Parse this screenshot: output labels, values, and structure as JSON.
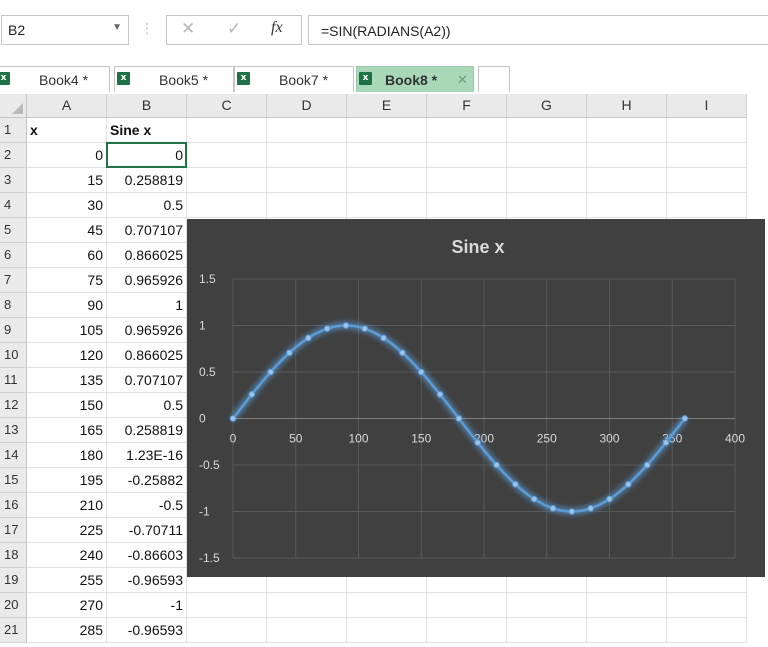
{
  "formula_bar": {
    "name_box": "B2",
    "cancel_icon": "✕",
    "enter_icon": "✓",
    "fx_label": "fx",
    "formula": "=SIN(RADIANS(A2))"
  },
  "tabs": [
    {
      "label": "Book4 *",
      "active": false
    },
    {
      "label": "Book5 *",
      "active": false
    },
    {
      "label": "Book7 *",
      "active": false
    },
    {
      "label": "Book8 *",
      "active": true,
      "close_icon": "✕"
    }
  ],
  "grid": {
    "columns": [
      "A",
      "B",
      "C",
      "D",
      "E",
      "F",
      "G",
      "H",
      "I"
    ],
    "rows": [
      {
        "num": "1",
        "a": "x",
        "b": "Sine x"
      },
      {
        "num": "2",
        "a": "0",
        "b": "0"
      },
      {
        "num": "3",
        "a": "15",
        "b": "0.258819"
      },
      {
        "num": "4",
        "a": "30",
        "b": "0.5"
      },
      {
        "num": "5",
        "a": "45",
        "b": "0.707107"
      },
      {
        "num": "6",
        "a": "60",
        "b": "0.866025"
      },
      {
        "num": "7",
        "a": "75",
        "b": "0.965926"
      },
      {
        "num": "8",
        "a": "90",
        "b": "1"
      },
      {
        "num": "9",
        "a": "105",
        "b": "0.965926"
      },
      {
        "num": "10",
        "a": "120",
        "b": "0.866025"
      },
      {
        "num": "11",
        "a": "135",
        "b": "0.707107"
      },
      {
        "num": "12",
        "a": "150",
        "b": "0.5"
      },
      {
        "num": "13",
        "a": "165",
        "b": "0.258819"
      },
      {
        "num": "14",
        "a": "180",
        "b": "1.23E-16"
      },
      {
        "num": "15",
        "a": "195",
        "b": "-0.25882"
      },
      {
        "num": "16",
        "a": "210",
        "b": "-0.5"
      },
      {
        "num": "17",
        "a": "225",
        "b": "-0.70711"
      },
      {
        "num": "18",
        "a": "240",
        "b": "-0.86603"
      },
      {
        "num": "19",
        "a": "255",
        "b": "-0.96593"
      },
      {
        "num": "20",
        "a": "270",
        "b": "-1"
      },
      {
        "num": "21",
        "a": "285",
        "b": "-0.96593"
      }
    ],
    "selected_cell": "B2"
  },
  "colors": {
    "chart_bg": "#404040",
    "series_line": "#5b9bd5",
    "axis_text": "#d9d9d9",
    "gridline": "#595959",
    "active_tab": "#a9d8b8",
    "selection": "#217346"
  },
  "chart_data": {
    "type": "scatter",
    "title": "Sine x",
    "xlabel": "",
    "ylabel": "",
    "xlim": [
      0,
      400
    ],
    "ylim": [
      -1.5,
      1.5
    ],
    "x_ticks": [
      "0",
      "50",
      "100",
      "150",
      "200",
      "250",
      "300",
      "350",
      "400"
    ],
    "y_ticks": [
      "1.5",
      "1",
      "0.5",
      "0",
      "-0.5",
      "-1",
      "-1.5"
    ],
    "grid": true,
    "smooth": true,
    "series": [
      {
        "x": [
          0,
          15,
          30,
          45,
          60,
          75,
          90,
          105,
          120,
          135,
          150,
          165,
          180,
          195,
          210,
          225,
          240,
          255,
          270,
          285,
          300,
          315,
          330,
          345,
          360
        ],
        "y": [
          0,
          0.258819,
          0.5,
          0.707107,
          0.866025,
          0.965926,
          1,
          0.965926,
          0.866025,
          0.707107,
          0.5,
          0.258819,
          0,
          -0.258819,
          -0.5,
          -0.707107,
          -0.866025,
          -0.965926,
          -1,
          -0.965926,
          -0.866025,
          -0.707107,
          -0.5,
          -0.258819,
          0
        ]
      }
    ]
  }
}
